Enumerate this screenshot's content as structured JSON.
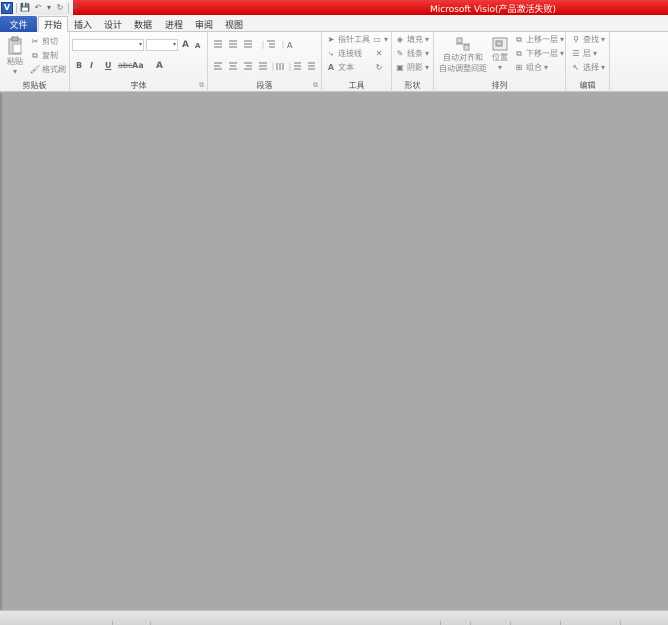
{
  "window": {
    "title": "Microsoft Visio(产品激活失败)"
  },
  "qat": {
    "app_icon": "V",
    "save": "💾",
    "undo": "↶",
    "undo_dd": "▾",
    "redo": "↻",
    "customize": "▾"
  },
  "tabs": [
    {
      "label": "文件"
    },
    {
      "label": "开始"
    },
    {
      "label": "插入"
    },
    {
      "label": "设计"
    },
    {
      "label": "数据"
    },
    {
      "label": "进程"
    },
    {
      "label": "审阅"
    },
    {
      "label": "视图"
    }
  ],
  "clipboard": {
    "paste": "粘贴",
    "cut": "剪切",
    "copy": "复制",
    "format_painter": "格式刷",
    "label": "剪贴板"
  },
  "font": {
    "label": "字体",
    "bold": "B",
    "italic": "I",
    "underline": "U",
    "strike": "abc",
    "case": "Aa",
    "color": "A",
    "grow": "A",
    "shrink": "A"
  },
  "paragraph": {
    "label": "段落"
  },
  "tools": {
    "pointer": "指针工具",
    "connector": "连接线",
    "text": "文本",
    "label": "工具"
  },
  "shape": {
    "fill": "填充",
    "line": "线条",
    "shadow": "阴影",
    "label": "形状"
  },
  "arrange": {
    "auto_align": "自动对齐和",
    "auto_space": "自动调整间距",
    "position": "位置",
    "bring_forward": "上移一层",
    "send_backward": "下移一层",
    "group": "组合",
    "label": "排列"
  },
  "editing": {
    "find": "查找",
    "layers": "层",
    "select": "选择",
    "label": "编辑"
  }
}
